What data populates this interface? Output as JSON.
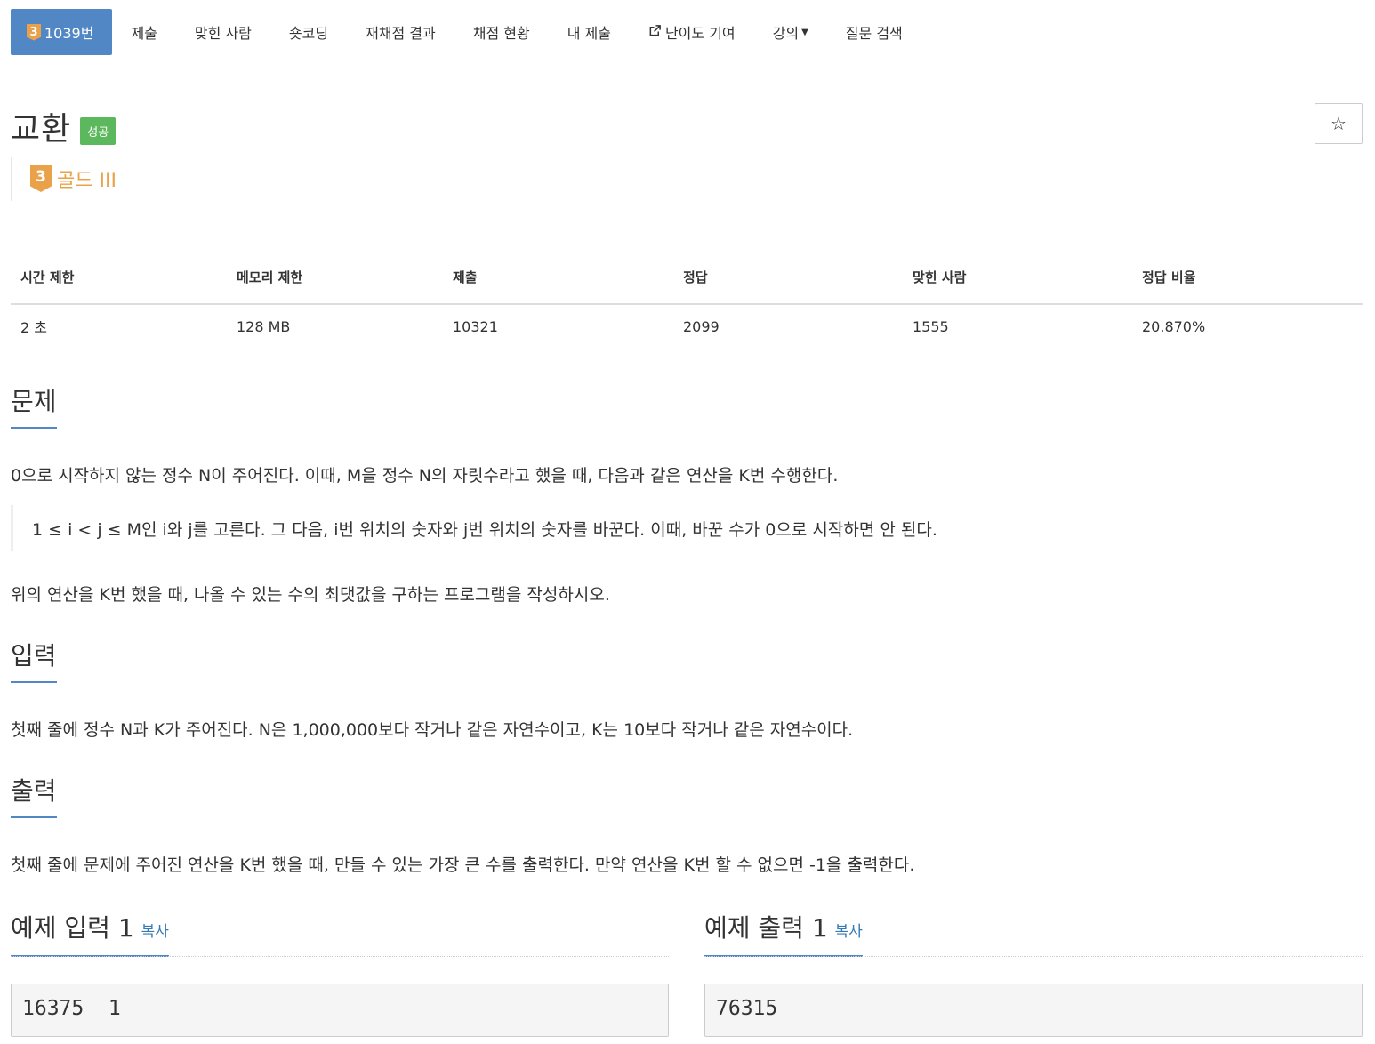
{
  "nav": {
    "problem_tier": "3",
    "problem_label": "1039번",
    "items": [
      "제출",
      "맞힌 사람",
      "숏코딩",
      "재채점 결과",
      "채점 현황",
      "내 제출",
      "난이도 기여",
      "강의",
      "질문 검색"
    ],
    "colors": {
      "active_bg": "#5287c6",
      "tier_gold": "#e9a24a"
    }
  },
  "problem": {
    "title": "교환",
    "status_label": "성공",
    "star_icon": "☆",
    "tier_number": "3",
    "tier_name": "골드 III"
  },
  "info": {
    "headers": [
      "시간 제한",
      "메모리 제한",
      "제출",
      "정답",
      "맞힌 사람",
      "정답 비율"
    ],
    "values": [
      "2 초",
      "128 MB",
      "10321",
      "2099",
      "1555",
      "20.870%"
    ]
  },
  "sections": {
    "problem_heading": "문제",
    "problem_text": "0으로 시작하지 않는 정수 N이 주어진다. 이때, M을 정수 N의 자릿수라고 했을 때, 다음과 같은 연산을 K번 수행한다.",
    "problem_quote": "1 ≤ i < j ≤ M인 i와 j를 고른다. 그 다음, i번 위치의 숫자와 j번 위치의 숫자를 바꾼다. 이때, 바꾼 수가 0으로 시작하면 안 된다.",
    "problem_text2": "위의 연산을 K번 했을 때, 나올 수 있는 수의 최댓값을 구하는 프로그램을 작성하시오.",
    "input_heading": "입력",
    "input_text": "첫째 줄에 정수 N과 K가 주어진다. N은 1,000,000보다 작거나 같은 자연수이고, K는 10보다 작거나 같은 자연수이다.",
    "output_heading": "출력",
    "output_text": "첫째 줄에 문제에 주어진 연산을 K번 했을 때, 만들 수 있는 가장 큰 수를 출력한다. 만약 연산을 K번 할 수 없으면 -1을 출력한다."
  },
  "samples": {
    "input_heading": "예제 입력 1",
    "output_heading": "예제 출력 1",
    "copy_label": "복사",
    "input_value": "16375 1",
    "output_value": "76315"
  }
}
